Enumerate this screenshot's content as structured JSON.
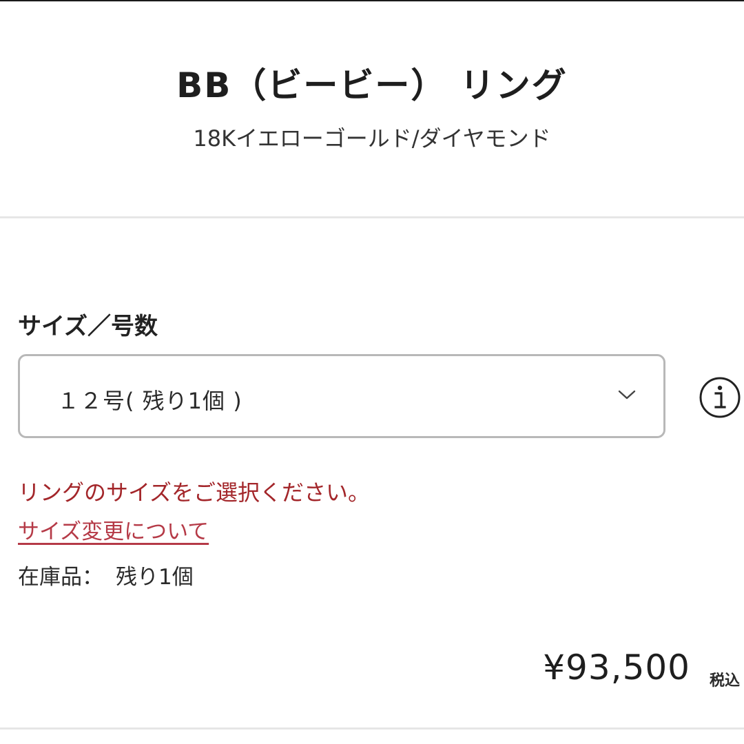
{
  "product": {
    "title": "BB（ビービー） リング",
    "subtitle": "18Kイエローゴールド/ダイヤモンド"
  },
  "size_selector": {
    "label": "サイズ／号数",
    "selected_value": "１２号( 残り1個 )",
    "chevron_icon": "chevron-down-icon",
    "info_icon": "info-icon"
  },
  "messages": {
    "error": "リングのサイズをご選択ください。",
    "size_change_link": "サイズ変更について"
  },
  "stock": {
    "label": "在庫品：",
    "value": "残り1個"
  },
  "price": {
    "amount": "¥93,500",
    "tax_note": "税込"
  },
  "colors": {
    "error_text": "#a3262a",
    "link_text": "#b53a47",
    "select_border": "#b8b8b8",
    "divider": "#e6e6e6"
  }
}
